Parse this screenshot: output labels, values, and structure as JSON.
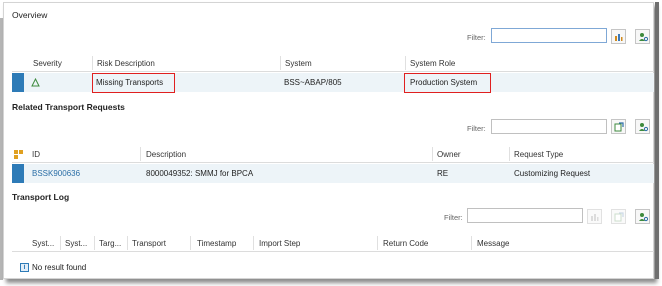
{
  "overview": {
    "title": "Overview",
    "filter_label": "Filter:",
    "filter_value": "",
    "columns": [
      "Severity",
      "Risk Description",
      "System",
      "System Role"
    ],
    "row": {
      "severity_icon": "triangle-outline-icon",
      "risk_description": "Missing Transports",
      "system": "BSS~ABAP/805",
      "system_role": "Production System"
    }
  },
  "related": {
    "title": "Related Transport Requests",
    "filter_label": "Filter:",
    "filter_value": "",
    "columns": [
      "ID",
      "Description",
      "Owner",
      "Request Type"
    ],
    "row": {
      "id": "BSSK900636",
      "description": "8000049352: SMMJ for BPCA",
      "owner": "RE",
      "request_type": "Customizing Request"
    }
  },
  "log": {
    "title": "Transport Log",
    "filter_label": "Filter:",
    "filter_value": "",
    "columns": [
      "Syst...",
      "Syst...",
      "Targ...",
      "Transport",
      "Timestamp",
      "Import Step",
      "Return Code",
      "Message"
    ],
    "empty_text": "No result found"
  },
  "colors": {
    "row_marker": "#2e7bb7",
    "row_background": "#edf4f8",
    "highlight": "#e02020",
    "link": "#2a6ea6"
  }
}
